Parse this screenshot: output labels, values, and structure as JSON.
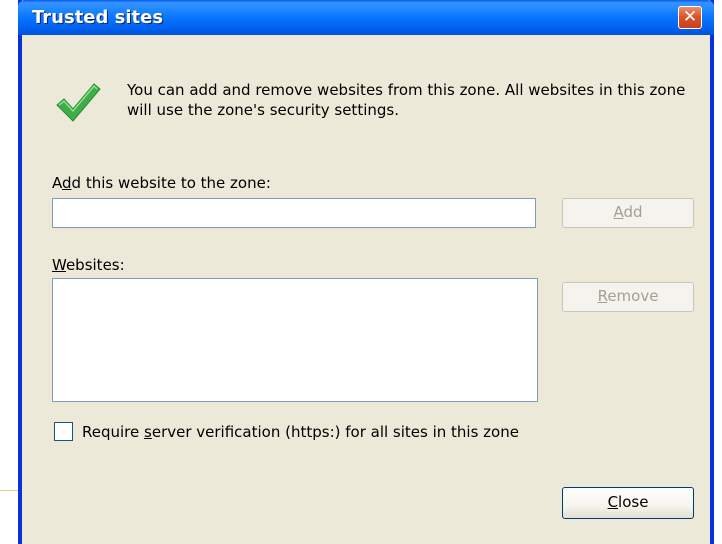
{
  "window": {
    "title": "Trusted sites",
    "close_glyph": "✕"
  },
  "intro": {
    "icon": "check-icon",
    "text": "You can add and remove websites from this zone. All websites in this zone will use the zone's security settings."
  },
  "add_section": {
    "label_pre": "A",
    "label_accel": "d",
    "label_post": "d this website to the zone:",
    "input_value": "",
    "add_button_accel": "A",
    "add_button_rest": "dd"
  },
  "websites_section": {
    "label_accel": "W",
    "label_rest": "ebsites:",
    "items": [],
    "remove_button_accel": "R",
    "remove_button_rest": "emove"
  },
  "verification": {
    "checked": false,
    "label_pre": "Require ",
    "label_accel": "s",
    "label_post": "erver verification (https:) for all sites in this zone"
  },
  "footer": {
    "close_accel": "C",
    "close_rest": "lose"
  },
  "colors": {
    "title_bar": "#0054e3",
    "dialog_bg": "#ece9d8",
    "close_button": "#d8562c",
    "check_green": "#3fae49"
  }
}
